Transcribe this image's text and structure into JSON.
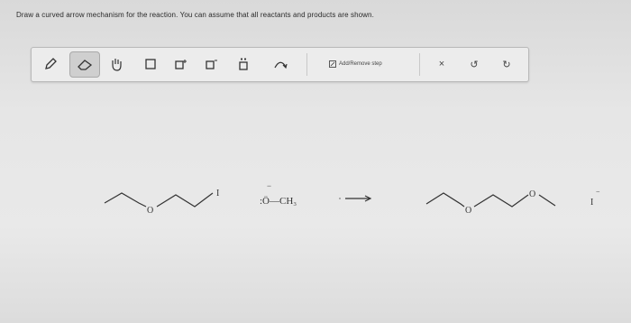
{
  "question": "Draw a curved arrow mechanism for the reaction. You can assume that all reactants and products are shown.",
  "toolbar": {
    "tools": [
      {
        "name": "pencil-tool",
        "glyph": "✎"
      },
      {
        "name": "eraser-tool",
        "glyph": "⌫"
      },
      {
        "name": "hand-tool",
        "glyph": "✋"
      },
      {
        "name": "box-tool",
        "glyph": "□"
      },
      {
        "name": "positive-charge-tool",
        "glyph": "□⁺"
      },
      {
        "name": "negative-charge-tool",
        "glyph": "□⁻"
      },
      {
        "name": "lone-pair-tool",
        "glyph": "□̈"
      },
      {
        "name": "curved-arrow-tool",
        "glyph": "↷"
      }
    ],
    "add_remove_label": "Add/Remove step",
    "actions": {
      "close": "×",
      "undo": "↺",
      "redo": "↻"
    }
  },
  "reaction": {
    "reactant1_o": "O",
    "reactant1_i": "I",
    "nucleophile": ":Ö—CH₃",
    "nucleophile_charge": "−",
    "product_o1": "O",
    "product_o2": "O",
    "byproduct": "I",
    "byproduct_charge": "−"
  }
}
